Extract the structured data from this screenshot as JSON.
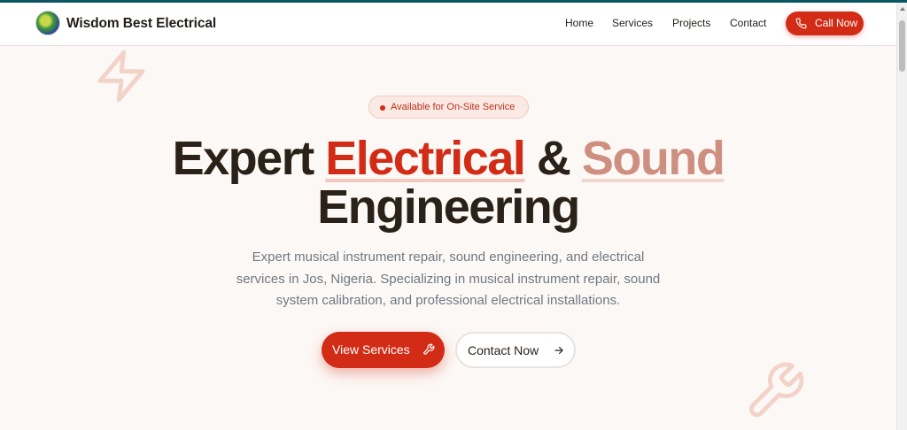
{
  "brand": {
    "name": "Wisdom Best Electrical",
    "logo_icon": "logo-globe-icon"
  },
  "nav": {
    "items": [
      {
        "label": "Home"
      },
      {
        "label": "Services"
      },
      {
        "label": "Projects"
      },
      {
        "label": "Contact"
      }
    ],
    "cta_label": "Call Now",
    "cta_icon": "phone-icon"
  },
  "hero": {
    "badge": "Available for On-Site Service",
    "title": {
      "part1": "Expert",
      "highlight1": "Electrical",
      "amp": "&",
      "highlight2": "Sound",
      "line2": "Engineering"
    },
    "description": "Expert musical instrument repair, sound engineering, and electrical services in Jos, Nigeria. Specializing in musical instrument repair, sound system calibration, and professional electrical installations.",
    "primary_button": "View Services",
    "primary_icon": "wrench-icon",
    "secondary_button": "Contact Now",
    "secondary_icon": "arrow-right-icon"
  },
  "decorations": {
    "top_left": "lightning-bolt-icon",
    "bottom_right": "wrench-icon"
  },
  "colors": {
    "accent": "#d22b16",
    "accent_soft": "#cf8f80",
    "text_dark": "#2a2118",
    "text_muted": "#6f7982",
    "background": "#fcf8f5",
    "top_bar": "#0b5560"
  }
}
